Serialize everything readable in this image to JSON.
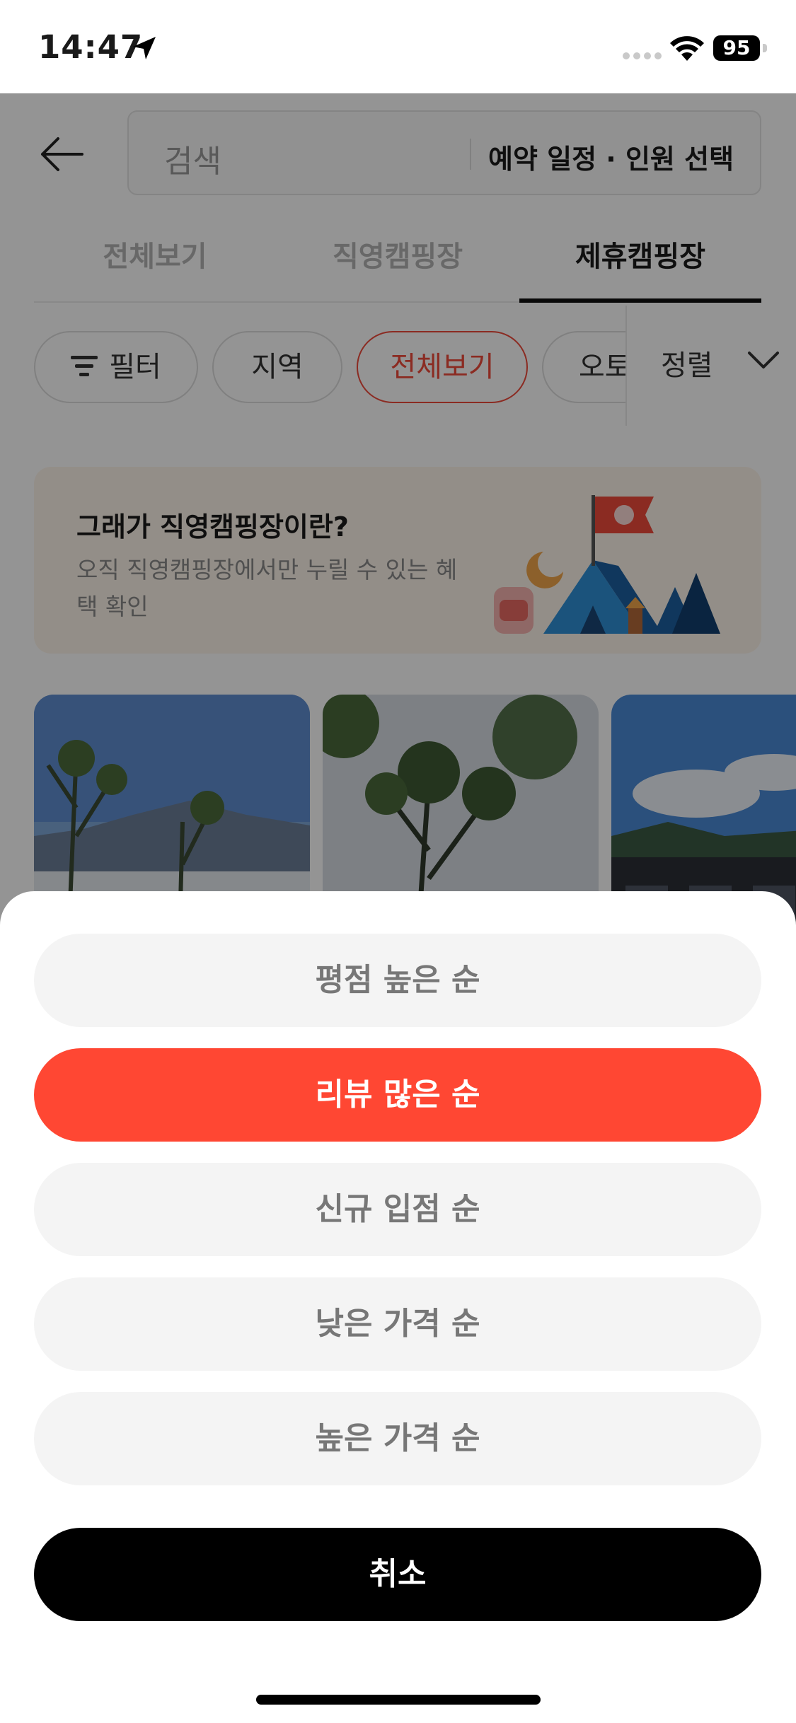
{
  "status_bar": {
    "time": "14:47",
    "battery": "95",
    "icons": [
      "location-arrow-icon",
      "signal-icon",
      "wifi-icon",
      "battery-icon"
    ]
  },
  "header": {
    "back_icon": "arrow-left-icon",
    "search_placeholder": "검색",
    "date_selector": "예약 일정 · 인원 선택"
  },
  "tabs": [
    {
      "label": "전체보기",
      "active": false
    },
    {
      "label": "직영캠핑장",
      "active": false
    },
    {
      "label": "제휴캠핑장",
      "active": true
    }
  ],
  "chips": [
    {
      "label": "필터",
      "icon": "filter-icon",
      "active": false
    },
    {
      "label": "지역",
      "active": false
    },
    {
      "label": "전체보기",
      "active": true
    },
    {
      "label": "오토",
      "active": false
    }
  ],
  "sort": {
    "label": "정렬",
    "icon": "chevron-down-icon"
  },
  "banner": {
    "title": "그래가 직영캠핑장이란?",
    "subtitle": "오직 직영캠핑장에서만 누릴 수 있는 혜택 확인"
  },
  "sort_sheet": {
    "options": [
      {
        "label": "평점 높은 순",
        "selected": false
      },
      {
        "label": "리뷰 많은 순",
        "selected": true
      },
      {
        "label": "신규 입점 순",
        "selected": false
      },
      {
        "label": "낮은 가격 순",
        "selected": false
      },
      {
        "label": "높은 가격 순",
        "selected": false
      }
    ],
    "cancel_label": "취소"
  },
  "colors": {
    "accent": "#ff4733",
    "chip_active": "#ef4a3c",
    "option_bg": "#f4f4f4",
    "option_text": "#777777",
    "cancel_bg": "#000000"
  }
}
